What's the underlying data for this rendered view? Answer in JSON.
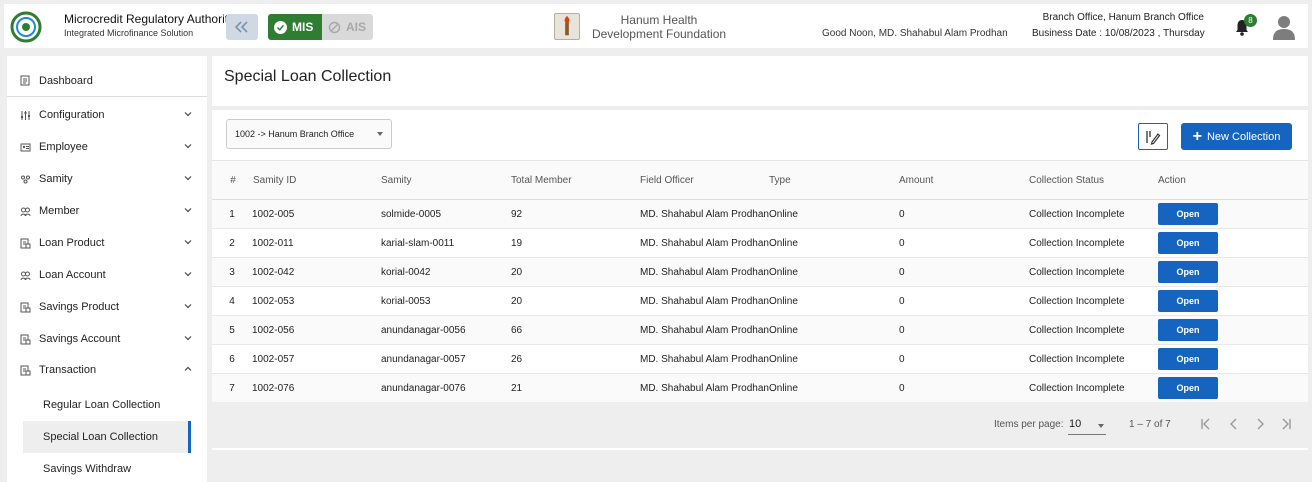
{
  "header": {
    "org_title": "Microcredit Regulatory Authority",
    "org_subtitle": "Integrated Microfinance Solution",
    "logo_text": "Microcredit Regulatory Authority",
    "mis_label": "MIS",
    "ais_label": "AIS",
    "foundation_name": "Hanum Health Development Foundation",
    "greeting": "Good Noon, MD. Shahabul Alam Prodhan",
    "branch_office": "Branch Office, Hanum Branch Office",
    "business_date": "Business Date : 10/08/2023 , Thursday",
    "notification_count": "8",
    "accent_color": "#2e7d32",
    "icons": {
      "collapse": "double-chevron-left-icon",
      "bell": "bell-icon",
      "avatar": "user-avatar-icon"
    }
  },
  "sidebar": {
    "items": [
      {
        "label": "Dashboard",
        "icon": "dashboard-icon",
        "expanded": null
      },
      {
        "label": "Configuration",
        "icon": "sliders-icon",
        "expanded": false
      },
      {
        "label": "Employee",
        "icon": "id-card-icon",
        "expanded": false
      },
      {
        "label": "Samity",
        "icon": "group-icon",
        "expanded": false
      },
      {
        "label": "Member",
        "icon": "members-icon",
        "expanded": false
      },
      {
        "label": "Loan Product",
        "icon": "document-icon",
        "expanded": false
      },
      {
        "label": "Loan Account",
        "icon": "members-icon",
        "expanded": false
      },
      {
        "label": "Savings Product",
        "icon": "document-icon",
        "expanded": false
      },
      {
        "label": "Savings Account",
        "icon": "document-icon",
        "expanded": false
      },
      {
        "label": "Transaction",
        "icon": "document-icon",
        "expanded": true
      }
    ],
    "sub_items": [
      {
        "label": "Regular Loan Collection",
        "active": false
      },
      {
        "label": "Special Loan Collection",
        "active": true
      },
      {
        "label": "Savings Withdraw",
        "active": false
      }
    ]
  },
  "main": {
    "page_title": "Special Loan Collection",
    "branch_select_value": "1002 -> Hanum Branch Office",
    "new_collection_label": "New Collection",
    "table": {
      "columns": [
        "#",
        "Samity ID",
        "Samity",
        "Total Member",
        "Field Officer",
        "Type",
        "Amount",
        "Collection Status",
        "Action"
      ],
      "rows": [
        {
          "num": "1",
          "samity_id": "1002-005",
          "samity": "solmide-0005",
          "total_member": "92",
          "field_officer": "MD. Shahabul Alam Prodhan",
          "type": "Online",
          "amount": "0",
          "status": "Collection Incomplete",
          "action": "Open"
        },
        {
          "num": "2",
          "samity_id": "1002-011",
          "samity": "karial-slam-0011",
          "total_member": "19",
          "field_officer": "MD. Shahabul Alam Prodhan",
          "type": "Online",
          "amount": "0",
          "status": "Collection Incomplete",
          "action": "Open"
        },
        {
          "num": "3",
          "samity_id": "1002-042",
          "samity": "korial-0042",
          "total_member": "20",
          "field_officer": "MD. Shahabul Alam Prodhan",
          "type": "Online",
          "amount": "0",
          "status": "Collection Incomplete",
          "action": "Open"
        },
        {
          "num": "4",
          "samity_id": "1002-053",
          "samity": "korial-0053",
          "total_member": "20",
          "field_officer": "MD. Shahabul Alam Prodhan",
          "type": "Online",
          "amount": "0",
          "status": "Collection Incomplete",
          "action": "Open"
        },
        {
          "num": "5",
          "samity_id": "1002-056",
          "samity": "anundanagar-0056",
          "total_member": "66",
          "field_officer": "MD. Shahabul Alam Prodhan",
          "type": "Online",
          "amount": "0",
          "status": "Collection Incomplete",
          "action": "Open"
        },
        {
          "num": "6",
          "samity_id": "1002-057",
          "samity": "anundanagar-0057",
          "total_member": "26",
          "field_officer": "MD. Shahabul Alam Prodhan",
          "type": "Online",
          "amount": "0",
          "status": "Collection Incomplete",
          "action": "Open"
        },
        {
          "num": "7",
          "samity_id": "1002-076",
          "samity": "anundanagar-0076",
          "total_member": "21",
          "field_officer": "MD. Shahabul Alam Prodhan",
          "type": "Online",
          "amount": "0",
          "status": "Collection Incomplete",
          "action": "Open"
        }
      ]
    },
    "paginator": {
      "items_per_page_label": "Items per page:",
      "items_per_page_value": "10",
      "range_label": "1 – 7 of 7"
    },
    "primary_color": "#1565c0"
  }
}
